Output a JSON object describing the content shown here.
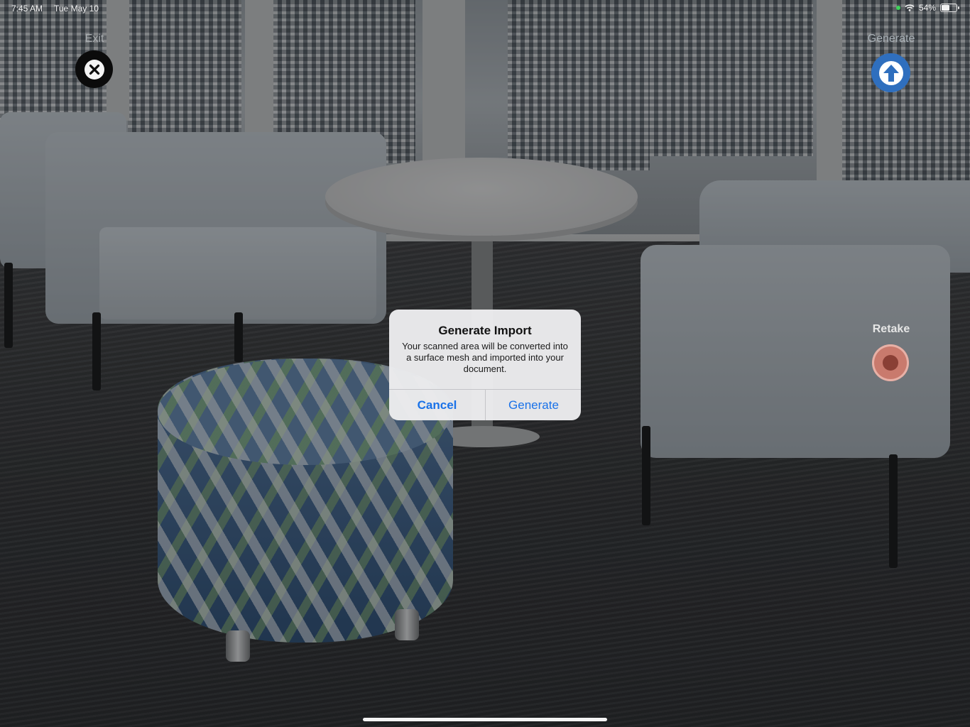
{
  "status_bar": {
    "time": "7:45 AM",
    "date": "Tue May 10",
    "battery_text": "54%",
    "battery_level": 0.54,
    "icons": [
      "green-dot",
      "wifi-icon",
      "battery-icon"
    ]
  },
  "controls": {
    "exit_label": "Exit",
    "exit_icon": "close-icon",
    "generate_label": "Generate",
    "generate_icon": "arrow-up-icon",
    "retake_label": "Retake",
    "retake_icon": "record-icon",
    "colors": {
      "generate": "#2f6fbe",
      "retake": "#c97a6d"
    }
  },
  "alert": {
    "title": "Generate Import",
    "message": "Your scanned area will be converted into a surface mesh and imported into your document.",
    "cancel_label": "Cancel",
    "generate_label": "Generate",
    "accent": "#1a72e8"
  }
}
